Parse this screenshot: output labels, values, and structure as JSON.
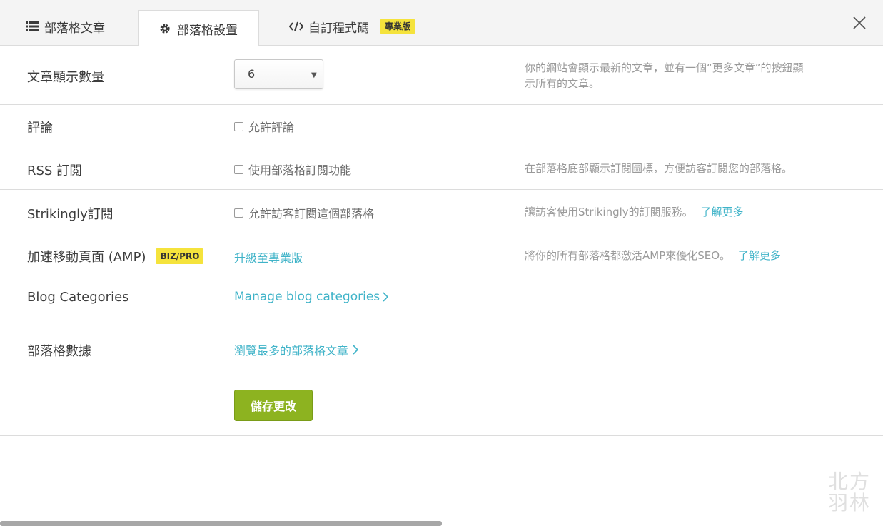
{
  "tabs": [
    {
      "label": "部落格文章",
      "icon": "list-icon"
    },
    {
      "label": "部落格設置",
      "icon": "gear-icon"
    },
    {
      "label": "自訂程式碼",
      "icon": "code-icon",
      "badge": "專業版"
    }
  ],
  "active_tab": "部落格設置",
  "settings": {
    "posts_count": {
      "label": "文章顯示數量",
      "value": "6",
      "help_line1": "你的網站會顯示最新的文章，並有一個“更多文章”的按鈕顯",
      "help_line2": "示所有的文章。"
    },
    "comments": {
      "label": "評論",
      "checkbox_label": "允許評論",
      "checked": false
    },
    "rss": {
      "label": "RSS 訂閱",
      "checkbox_label": "使用部落格訂閱功能",
      "checked": false,
      "help": "在部落格底部顯示訂閱圖標，方便訪客訂閱您的部落格。"
    },
    "strikingly_sub": {
      "label": "Strikingly訂閱",
      "checkbox_label": "允許訪客訂閱這個部落格",
      "checked": false,
      "help": "讓訪客使用Strikingly的訂閱服務。",
      "help_link": "了解更多"
    },
    "amp": {
      "label": "加速移動頁面 (AMP)",
      "badge": "BIZ/PRO",
      "upgrade_link": "升級至專業版",
      "help": "將你的所有部落格都激活AMP來優化SEO。",
      "help_link": "了解更多"
    },
    "categories": {
      "label": "Blog Categories",
      "link": "Manage blog categories"
    },
    "stats": {
      "label": "部落格數據",
      "link": "瀏覽最多的部落格文章"
    }
  },
  "save_button": "儲存更改",
  "watermark": "北方羽林",
  "colors": {
    "accent_link": "#3fb3c8",
    "badge_yellow": "#f5e33c",
    "save_green": "#8db320"
  }
}
